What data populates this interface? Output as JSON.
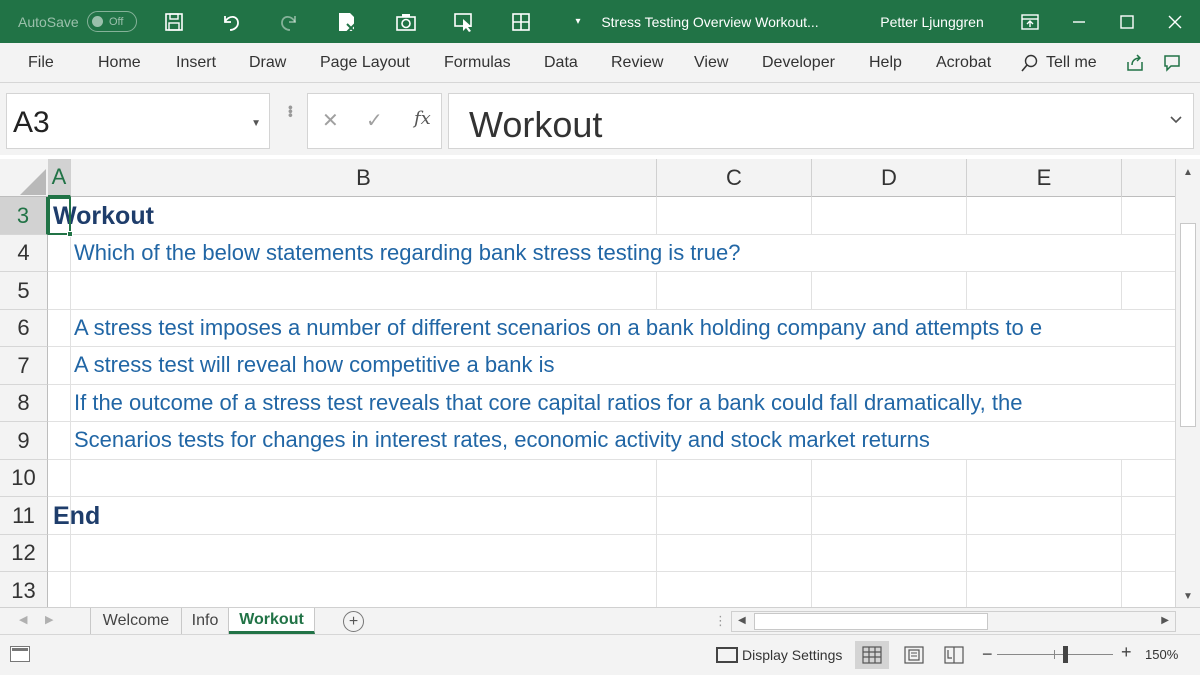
{
  "titlebar": {
    "autosave_label": "AutoSave",
    "autosave_state": "Off",
    "doc_title": "Stress Testing Overview Workout...",
    "user": "Petter Ljunggren",
    "bg_color": "#217346"
  },
  "ribbon": {
    "tabs": [
      "File",
      "Home",
      "Insert",
      "Draw",
      "Page Layout",
      "Formulas",
      "Data",
      "Review",
      "View",
      "Developer",
      "Help",
      "Acrobat",
      "Tell me"
    ]
  },
  "formula_bar": {
    "name_box": "A3",
    "content": "Workout"
  },
  "grid": {
    "columns": [
      "A",
      "B",
      "C",
      "D",
      "E"
    ],
    "rows": [
      "3",
      "4",
      "5",
      "6",
      "7",
      "8",
      "9",
      "10",
      "11",
      "12",
      "13"
    ],
    "cells": {
      "r3": "Workout",
      "r4": "Which of the below statements regarding bank stress testing is true?",
      "r6": "A stress test imposes a number of different scenarios on a bank holding company and attempts to e",
      "r7": "A stress test will reveal how competitive a bank is",
      "r8": "If the outcome of a stress test reveals that core capital ratios for a bank could fall dramatically, the",
      "r9": "Scenarios tests for changes in interest rates, economic activity and stock market returns",
      "r11": "End"
    },
    "active_cell": "A3"
  },
  "sheets": {
    "tabs": [
      "Welcome",
      "Info",
      "Workout"
    ],
    "active": "Workout"
  },
  "statusbar": {
    "display_settings": "Display Settings",
    "zoom": "150%",
    "zoom_fraction": 0.59
  }
}
